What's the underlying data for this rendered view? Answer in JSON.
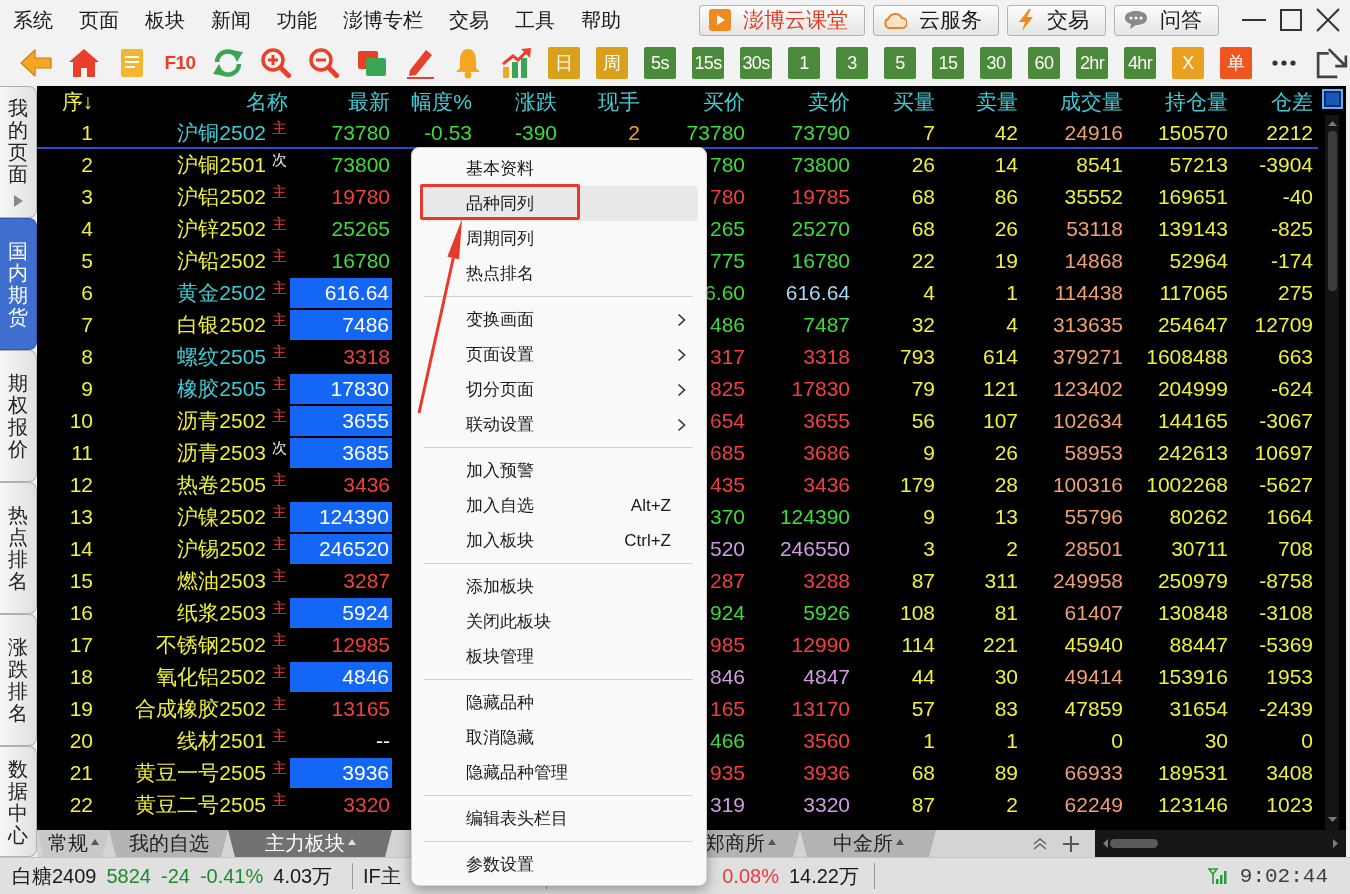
{
  "menu_bar": [
    "系统",
    "页面",
    "板块",
    "新闻",
    "功能",
    "澎博专栏",
    "交易",
    "工具",
    "帮助"
  ],
  "services": [
    {
      "label": "澎博云课堂",
      "color": "#e03a1e"
    },
    {
      "label": "云服务",
      "color": "#1a1a1a"
    },
    {
      "label": "交易",
      "color": "#1a1a1a"
    },
    {
      "label": "问答",
      "color": "#1a1a1a"
    }
  ],
  "toolbar": {
    "f10_label": "F10",
    "buttons": [
      {
        "label": "日",
        "color": "#d9a01c"
      },
      {
        "label": "周",
        "color": "#d9a01c"
      },
      {
        "label": "5s",
        "color": "#4a8a3a"
      },
      {
        "label": "15s",
        "color": "#4a8a3a"
      },
      {
        "label": "30s",
        "color": "#4a8a3a"
      },
      {
        "label": "1",
        "color": "#4a8a3a"
      },
      {
        "label": "3",
        "color": "#4a8a3a"
      },
      {
        "label": "5",
        "color": "#4a8a3a"
      },
      {
        "label": "15",
        "color": "#4a8a3a"
      },
      {
        "label": "30",
        "color": "#4a8a3a"
      },
      {
        "label": "60",
        "color": "#4a8a3a"
      },
      {
        "label": "2hr",
        "color": "#4a8a3a"
      },
      {
        "label": "4hr",
        "color": "#4a8a3a"
      },
      {
        "label": "X",
        "color": "#eca020"
      },
      {
        "label": "单",
        "color": "#f05420"
      }
    ]
  },
  "sidebar": {
    "tabs": [
      {
        "label": "我的页面",
        "selected": false,
        "arrow": true
      },
      {
        "label": "国内期货",
        "selected": true,
        "arrow": false
      },
      {
        "label": "期权报价",
        "selected": false,
        "arrow": false
      },
      {
        "label": "热点排名",
        "selected": false,
        "arrow": false
      },
      {
        "label": "涨跌排名",
        "selected": false,
        "arrow": false
      },
      {
        "label": "数据中心",
        "selected": false,
        "arrow": false
      }
    ]
  },
  "table": {
    "columns": [
      {
        "label": "序↓",
        "sorted": true
      },
      {
        "label": "名称",
        "sorted": false
      },
      {
        "label": "最新",
        "sorted": false
      },
      {
        "label": "幅度%",
        "sorted": false
      },
      {
        "label": "涨跌",
        "sorted": false
      },
      {
        "label": "现手",
        "sorted": false
      },
      {
        "label": "买价",
        "sorted": false
      },
      {
        "label": "卖价",
        "sorted": false
      },
      {
        "label": "买量",
        "sorted": false
      },
      {
        "label": "卖量",
        "sorted": false
      },
      {
        "label": "成交量",
        "sorted": false
      },
      {
        "label": "持仓量",
        "sorted": false
      },
      {
        "label": "仓差",
        "sorted": false
      }
    ],
    "rows": [
      {
        "selected": true,
        "no": "1",
        "name": {
          "text": "沪铜2502",
          "color": "#40ccd6"
        },
        "tag": {
          "text": "主",
          "color": "#f04040"
        },
        "latest": {
          "text": "73780",
          "color": "#3cdc3c",
          "highlight": false
        },
        "change_pct": {
          "text": "-0.53",
          "color": "#3cdc3c"
        },
        "change": {
          "text": "-390",
          "color": "#3cdc3c"
        },
        "last_volume": {
          "text": "2",
          "color": "#f0a030"
        },
        "bid": {
          "text": "73780",
          "color": "#3cdc3c"
        },
        "ask": {
          "text": "73790",
          "color": "#3cdc3c"
        },
        "bid_volume": "7",
        "ask_volume": "42",
        "volume": {
          "text": "24916",
          "color": "#f0a070"
        },
        "open_interest": "150570",
        "oi_change": "2212"
      },
      {
        "selected": false,
        "no": "2",
        "name": {
          "text": "沪铜2501",
          "color": "#f0f03c"
        },
        "tag": {
          "text": "次",
          "color": "#f0f0f0"
        },
        "latest": {
          "text": "73800",
          "color": "#3cdc3c",
          "highlight": false
        },
        "bid": {
          "text": "780",
          "color": "#3cdc3c"
        },
        "ask": {
          "text": "73800",
          "color": "#3cdc3c"
        },
        "bid_volume": "26",
        "ask_volume": "14",
        "volume": {
          "text": "8541",
          "color": "#f0f03c"
        },
        "open_interest": "57213",
        "oi_change": "-3904"
      },
      {
        "selected": false,
        "no": "3",
        "name": {
          "text": "沪铝2502",
          "color": "#f0f03c"
        },
        "tag": {
          "text": "主",
          "color": "#f04040"
        },
        "latest": {
          "text": "19780",
          "color": "#f04040",
          "highlight": false
        },
        "bid": {
          "text": "780",
          "color": "#f04040"
        },
        "ask": {
          "text": "19785",
          "color": "#f04040"
        },
        "bid_volume": "68",
        "ask_volume": "86",
        "volume": {
          "text": "35552",
          "color": "#f0f03c"
        },
        "open_interest": "169651",
        "oi_change": "-40"
      },
      {
        "selected": false,
        "no": "4",
        "name": {
          "text": "沪锌2502",
          "color": "#f0f03c"
        },
        "tag": {
          "text": "主",
          "color": "#f04040"
        },
        "latest": {
          "text": "25265",
          "color": "#3cdc3c",
          "highlight": false
        },
        "bid": {
          "text": "265",
          "color": "#3cdc3c"
        },
        "ask": {
          "text": "25270",
          "color": "#3cdc3c"
        },
        "bid_volume": "68",
        "ask_volume": "26",
        "volume": {
          "text": "53118",
          "color": "#f0a070"
        },
        "open_interest": "139143",
        "oi_change": "-825"
      },
      {
        "selected": false,
        "no": "5",
        "name": {
          "text": "沪铅2502",
          "color": "#f0f03c"
        },
        "tag": {
          "text": "主",
          "color": "#f04040"
        },
        "latest": {
          "text": "16780",
          "color": "#3cdc3c",
          "highlight": false
        },
        "bid": {
          "text": "775",
          "color": "#3cdc3c"
        },
        "ask": {
          "text": "16780",
          "color": "#3cdc3c"
        },
        "bid_volume": "22",
        "ask_volume": "19",
        "volume": {
          "text": "14868",
          "color": "#f0a070"
        },
        "open_interest": "52964",
        "oi_change": "-174"
      },
      {
        "selected": false,
        "no": "6",
        "name": {
          "text": "黄金2502",
          "color": "#40ccd6"
        },
        "tag": {
          "text": "主",
          "color": "#f04040"
        },
        "latest": {
          "text": "616.64",
          "highlight": true
        },
        "bid": {
          "text": "6.60",
          "color": "#3cdc3c"
        },
        "ask": {
          "text": "616.64",
          "color": "#a8d4f4"
        },
        "bid_volume": "4",
        "ask_volume": "1",
        "volume": {
          "text": "114438",
          "color": "#f0a070"
        },
        "open_interest": "117065",
        "oi_change": "275"
      },
      {
        "selected": false,
        "no": "7",
        "name": {
          "text": "白银2502",
          "color": "#f0f03c"
        },
        "tag": {
          "text": "主",
          "color": "#f04040"
        },
        "latest": {
          "text": "7486",
          "highlight": true
        },
        "bid": {
          "text": "486",
          "color": "#3cdc3c"
        },
        "ask": {
          "text": "7487",
          "color": "#3cdc3c"
        },
        "bid_volume": "32",
        "ask_volume": "4",
        "volume": {
          "text": "313635",
          "color": "#f0a070"
        },
        "open_interest": "254647",
        "oi_change": "12709"
      },
      {
        "selected": false,
        "no": "8",
        "name": {
          "text": "螺纹2505",
          "color": "#40ccd6"
        },
        "tag": {
          "text": "主",
          "color": "#f04040"
        },
        "latest": {
          "text": "3318",
          "color": "#f04040",
          "highlight": false
        },
        "bid": {
          "text": "317",
          "color": "#f04040"
        },
        "ask": {
          "text": "3318",
          "color": "#f04040"
        },
        "bid_volume": "793",
        "ask_volume": "614",
        "volume": {
          "text": "379271",
          "color": "#f0a070"
        },
        "open_interest": "1608488",
        "oi_change": "663"
      },
      {
        "selected": false,
        "no": "9",
        "name": {
          "text": "橡胶2505",
          "color": "#40ccd6"
        },
        "tag": {
          "text": "主",
          "color": "#f04040"
        },
        "latest": {
          "text": "17830",
          "highlight": true
        },
        "bid": {
          "text": "825",
          "color": "#f04040"
        },
        "ask": {
          "text": "17830",
          "color": "#f04040"
        },
        "bid_volume": "79",
        "ask_volume": "121",
        "volume": {
          "text": "123402",
          "color": "#f0a070"
        },
        "open_interest": "204999",
        "oi_change": "-624"
      },
      {
        "selected": false,
        "no": "10",
        "name": {
          "text": "沥青2502",
          "color": "#f0f03c"
        },
        "tag": {
          "text": "主",
          "color": "#f04040"
        },
        "latest": {
          "text": "3655",
          "highlight": true
        },
        "bid": {
          "text": "654",
          "color": "#f04040"
        },
        "ask": {
          "text": "3655",
          "color": "#f04040"
        },
        "bid_volume": "56",
        "ask_volume": "107",
        "volume": {
          "text": "102634",
          "color": "#f0a070"
        },
        "open_interest": "144165",
        "oi_change": "-3067"
      },
      {
        "selected": false,
        "no": "11",
        "name": {
          "text": "沥青2503",
          "color": "#f0f03c"
        },
        "tag": {
          "text": "次",
          "color": "#f0f0f0"
        },
        "latest": {
          "text": "3685",
          "highlight": true
        },
        "bid": {
          "text": "685",
          "color": "#f04040"
        },
        "ask": {
          "text": "3686",
          "color": "#f04040"
        },
        "bid_volume": "9",
        "ask_volume": "26",
        "volume": {
          "text": "58953",
          "color": "#f0a070"
        },
        "open_interest": "242613",
        "oi_change": "10697"
      },
      {
        "selected": false,
        "no": "12",
        "name": {
          "text": "热卷2505",
          "color": "#f0f03c"
        },
        "tag": {
          "text": "主",
          "color": "#f04040"
        },
        "latest": {
          "text": "3436",
          "color": "#f04040",
          "highlight": false
        },
        "bid": {
          "text": "435",
          "color": "#f04040"
        },
        "ask": {
          "text": "3436",
          "color": "#f04040"
        },
        "bid_volume": "179",
        "ask_volume": "28",
        "volume": {
          "text": "100316",
          "color": "#f0a070"
        },
        "open_interest": "1002268",
        "oi_change": "-5627"
      },
      {
        "selected": false,
        "no": "13",
        "name": {
          "text": "沪镍2502",
          "color": "#f0f03c"
        },
        "tag": {
          "text": "主",
          "color": "#f04040"
        },
        "latest": {
          "text": "124390",
          "highlight": true
        },
        "bid": {
          "text": "370",
          "color": "#3cdc3c"
        },
        "ask": {
          "text": "124390",
          "color": "#3cdc3c"
        },
        "bid_volume": "9",
        "ask_volume": "13",
        "volume": {
          "text": "55796",
          "color": "#f0a070"
        },
        "open_interest": "80262",
        "oi_change": "1664"
      },
      {
        "selected": false,
        "no": "14",
        "name": {
          "text": "沪锡2502",
          "color": "#f0f03c"
        },
        "tag": {
          "text": "主",
          "color": "#f04040"
        },
        "latest": {
          "text": "246520",
          "highlight": true
        },
        "bid": {
          "text": "520",
          "color": "#d49ae6"
        },
        "ask": {
          "text": "246550",
          "color": "#d49ae6"
        },
        "bid_volume": "3",
        "ask_volume": "2",
        "volume": {
          "text": "28501",
          "color": "#f0a070"
        },
        "open_interest": "30711",
        "oi_change": "708"
      },
      {
        "selected": false,
        "no": "15",
        "name": {
          "text": "燃油2503",
          "color": "#f0f03c"
        },
        "tag": {
          "text": "主",
          "color": "#f04040"
        },
        "latest": {
          "text": "3287",
          "color": "#f04040",
          "highlight": false
        },
        "bid": {
          "text": "287",
          "color": "#f04040"
        },
        "ask": {
          "text": "3288",
          "color": "#f04040"
        },
        "bid_volume": "87",
        "ask_volume": "311",
        "volume": {
          "text": "249958",
          "color": "#f0a070"
        },
        "open_interest": "250979",
        "oi_change": "-8758"
      },
      {
        "selected": false,
        "no": "16",
        "name": {
          "text": "纸浆2503",
          "color": "#f0f03c"
        },
        "tag": {
          "text": "主",
          "color": "#f04040"
        },
        "latest": {
          "text": "5924",
          "highlight": true
        },
        "bid": {
          "text": "924",
          "color": "#3cdc3c"
        },
        "ask": {
          "text": "5926",
          "color": "#3cdc3c"
        },
        "bid_volume": "108",
        "ask_volume": "81",
        "volume": {
          "text": "61407",
          "color": "#f0a070"
        },
        "open_interest": "130848",
        "oi_change": "-3108"
      },
      {
        "selected": false,
        "no": "17",
        "name": {
          "text": "不锈钢2502",
          "color": "#f0f03c"
        },
        "tag": {
          "text": "主",
          "color": "#f04040"
        },
        "latest": {
          "text": "12985",
          "color": "#f04040",
          "highlight": false
        },
        "bid": {
          "text": "985",
          "color": "#f04040"
        },
        "ask": {
          "text": "12990",
          "color": "#f04040"
        },
        "bid_volume": "114",
        "ask_volume": "221",
        "volume": {
          "text": "45940",
          "color": "#f0f03c"
        },
        "open_interest": "88447",
        "oi_change": "-5369"
      },
      {
        "selected": false,
        "no": "18",
        "name": {
          "text": "氧化铝2502",
          "color": "#f0f03c"
        },
        "tag": {
          "text": "主",
          "color": "#f04040"
        },
        "latest": {
          "text": "4846",
          "highlight": true
        },
        "bid": {
          "text": "846",
          "color": "#d49ae6"
        },
        "ask": {
          "text": "4847",
          "color": "#d49ae6"
        },
        "bid_volume": "44",
        "ask_volume": "30",
        "volume": {
          "text": "49414",
          "color": "#f0a070"
        },
        "open_interest": "153916",
        "oi_change": "1953"
      },
      {
        "selected": false,
        "no": "19",
        "name": {
          "text": "合成橡胶2502",
          "color": "#f0f03c"
        },
        "tag": {
          "text": "主",
          "color": "#f04040"
        },
        "latest": {
          "text": "13165",
          "color": "#f04040",
          "highlight": false
        },
        "bid": {
          "text": "165",
          "color": "#f04040"
        },
        "ask": {
          "text": "13170",
          "color": "#f04040"
        },
        "bid_volume": "57",
        "ask_volume": "83",
        "volume": {
          "text": "47859",
          "color": "#f0f03c"
        },
        "open_interest": "31654",
        "oi_change": "-2439"
      },
      {
        "selected": false,
        "no": "20",
        "name": {
          "text": "线材2501",
          "color": "#f0f03c"
        },
        "tag": {
          "text": "主",
          "color": "#f04040"
        },
        "latest": {
          "text": "--",
          "color": "#ffffff",
          "highlight": false
        },
        "bid": {
          "text": "466",
          "color": "#3cdc3c"
        },
        "ask": {
          "text": "3560",
          "color": "#f04040"
        },
        "bid_volume": "1",
        "ask_volume": "1",
        "volume": {
          "text": "0",
          "color": "#f0f03c"
        },
        "open_interest": "30",
        "oi_change": "0"
      },
      {
        "selected": false,
        "no": "21",
        "name": {
          "text": "黄豆一号2505",
          "color": "#f0f03c"
        },
        "tag": {
          "text": "主",
          "color": "#f04040"
        },
        "latest": {
          "text": "3936",
          "highlight": true
        },
        "bid": {
          "text": "935",
          "color": "#f04040"
        },
        "ask": {
          "text": "3936",
          "color": "#f04040"
        },
        "bid_volume": "68",
        "ask_volume": "89",
        "volume": {
          "text": "66933",
          "color": "#f0a070"
        },
        "open_interest": "189531",
        "oi_change": "3408"
      },
      {
        "selected": false,
        "no": "22",
        "name": {
          "text": "黄豆二号2505",
          "color": "#f0f03c"
        },
        "tag": {
          "text": "主",
          "color": "#f04040"
        },
        "latest": {
          "text": "3320",
          "color": "#f04040",
          "highlight": false
        },
        "bid": {
          "text": "319",
          "color": "#d49ae6"
        },
        "ask": {
          "text": "3320",
          "color": "#d49ae6"
        },
        "bid_volume": "87",
        "ask_volume": "2",
        "volume": {
          "text": "62249",
          "color": "#f0a070"
        },
        "open_interest": "123146",
        "oi_change": "1023"
      }
    ]
  },
  "sheet_tabs": [
    {
      "label": "常规",
      "selected": false,
      "caret": true
    },
    {
      "label": "我的自选",
      "selected": false,
      "caret": false
    },
    {
      "label": "主力板块",
      "selected": true,
      "caret": true
    },
    {
      "label": "郑商所",
      "selected": false,
      "caret": true
    },
    {
      "label": "中金所",
      "selected": false,
      "caret": true
    }
  ],
  "context_menu": {
    "items": [
      {
        "kind": "item",
        "label": "基本资料",
        "hovered": false,
        "submenu": false,
        "annotated": false
      },
      {
        "kind": "item",
        "label": "品种同列",
        "hovered": true,
        "submenu": false,
        "annotated": true
      },
      {
        "kind": "item",
        "label": "周期同列",
        "hovered": false,
        "submenu": false,
        "annotated": false
      },
      {
        "kind": "item",
        "label": "热点排名",
        "hovered": false,
        "submenu": false,
        "annotated": false
      },
      {
        "kind": "separator"
      },
      {
        "kind": "item",
        "label": "变换画面",
        "hovered": false,
        "submenu": true,
        "annotated": false
      },
      {
        "kind": "item",
        "label": "页面设置",
        "hovered": false,
        "submenu": true,
        "annotated": false
      },
      {
        "kind": "item",
        "label": "切分页面",
        "hovered": false,
        "submenu": true,
        "annotated": false
      },
      {
        "kind": "item",
        "label": "联动设置",
        "hovered": false,
        "submenu": true,
        "annotated": false
      },
      {
        "kind": "separator"
      },
      {
        "kind": "item",
        "label": "加入预警",
        "hovered": false,
        "submenu": false,
        "annotated": false
      },
      {
        "kind": "item",
        "label": "加入自选",
        "shortcut": "Alt+Z",
        "hovered": false,
        "submenu": false,
        "annotated": false
      },
      {
        "kind": "item",
        "label": "加入板块",
        "shortcut": "Ctrl+Z",
        "hovered": false,
        "submenu": false,
        "annotated": false
      },
      {
        "kind": "separator"
      },
      {
        "kind": "item",
        "label": "添加板块",
        "hovered": false,
        "submenu": false,
        "annotated": false
      },
      {
        "kind": "item",
        "label": "关闭此板块",
        "hovered": false,
        "submenu": false,
        "annotated": false
      },
      {
        "kind": "item",
        "label": "板块管理",
        "hovered": false,
        "submenu": false,
        "annotated": false
      },
      {
        "kind": "separator"
      },
      {
        "kind": "item",
        "label": "隐藏品种",
        "hovered": false,
        "submenu": false,
        "annotated": false
      },
      {
        "kind": "item",
        "label": "取消隐藏",
        "hovered": false,
        "submenu": false,
        "annotated": false
      },
      {
        "kind": "item",
        "label": "隐藏品种管理",
        "hovered": false,
        "submenu": false,
        "annotated": false
      },
      {
        "kind": "separator"
      },
      {
        "kind": "item",
        "label": "编辑表头栏目",
        "hovered": false,
        "submenu": false,
        "annotated": false
      },
      {
        "kind": "separator"
      },
      {
        "kind": "item",
        "label": "参数设置",
        "hovered": false,
        "submenu": false,
        "annotated": false
      }
    ]
  },
  "status_bar": {
    "segments": [
      {
        "texts": [
          {
            "text": "白糖2409",
            "color": "#1a1a1a"
          },
          {
            "text": "5824",
            "color": "#1e8a2a"
          },
          {
            "text": "-24",
            "color": "#1e8a2a"
          },
          {
            "text": "-0.41%",
            "color": "#1e8a2a"
          },
          {
            "text": "4.03万",
            "color": "#1a1a1a"
          }
        ]
      },
      {
        "texts": [
          {
            "text": "IF主",
            "color": "#1a1a1a"
          }
        ]
      },
      {
        "texts": [
          {
            "text": "0.08%",
            "color": "#e83c3c"
          },
          {
            "text": "14.22万",
            "color": "#1a1a1a"
          }
        ]
      }
    ],
    "time": "9:02:44"
  }
}
